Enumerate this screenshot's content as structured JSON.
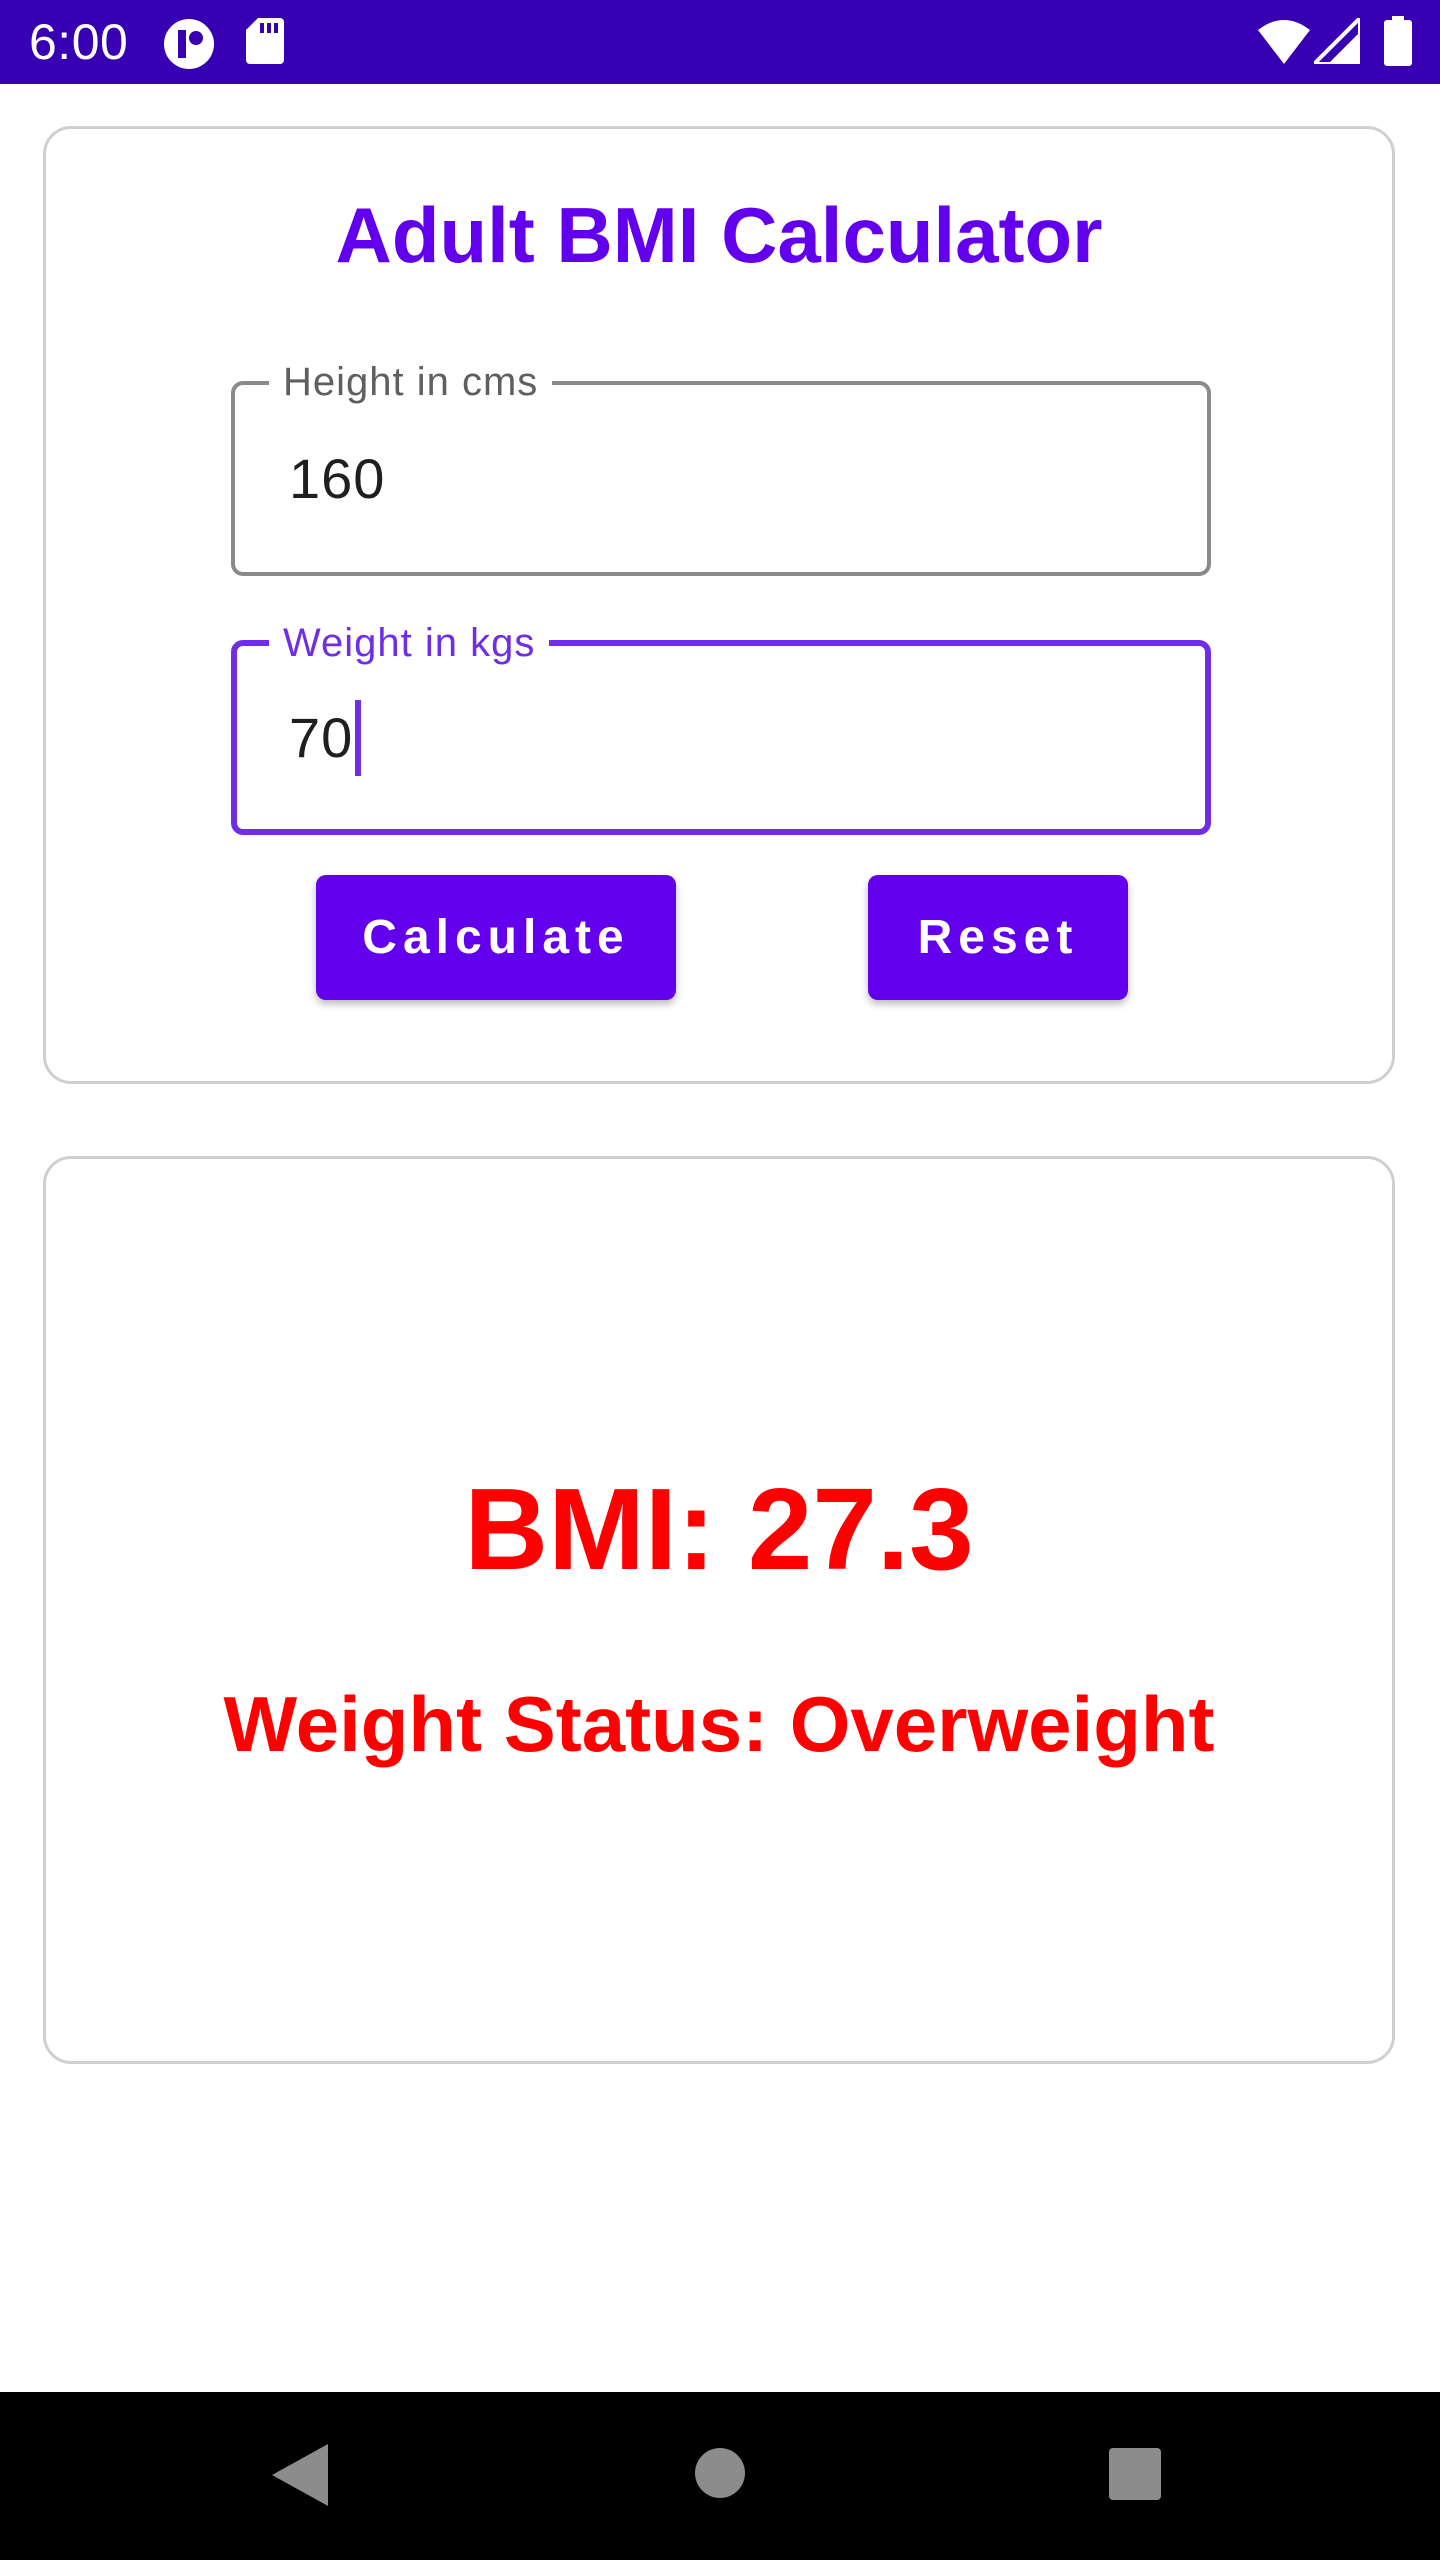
{
  "status_bar": {
    "time": "6:00",
    "bg_color": "#3700b3",
    "icons": [
      "app-notification-icon",
      "sd-card-icon",
      "wifi-icon",
      "cell-signal-icon",
      "battery-icon"
    ]
  },
  "app": {
    "title": "Adult BMI Calculator",
    "accent_color": "#6200ee",
    "height_field": {
      "label": "Height in cms",
      "value": "160"
    },
    "weight_field": {
      "label": "Weight in kgs",
      "value": "70",
      "focused": true
    },
    "buttons": {
      "calculate": "Calculate",
      "reset": "Reset"
    },
    "result": {
      "bmi_text": "BMI: 27.3",
      "status_text": "Weight Status: Overweight",
      "color": "#ff0000"
    }
  },
  "nav_bar": {
    "icons": [
      "back-icon",
      "home-icon",
      "recents-icon"
    ]
  }
}
